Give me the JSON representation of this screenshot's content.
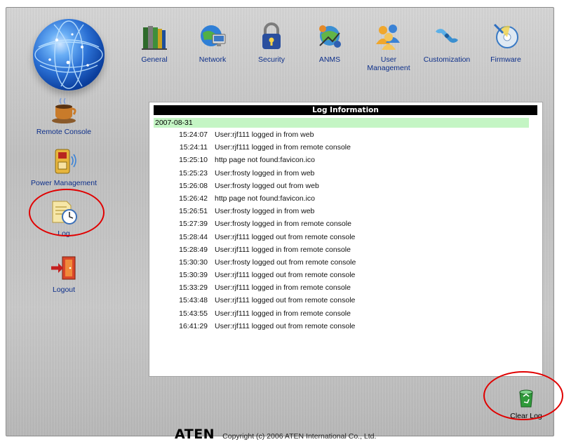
{
  "nav": {
    "items": [
      {
        "label": "General",
        "icon": "books-icon"
      },
      {
        "label": "Network",
        "icon": "network-icon"
      },
      {
        "label": "Security",
        "icon": "lock-icon"
      },
      {
        "label": "ANMS",
        "icon": "anms-icon"
      },
      {
        "label": "User\nManagement",
        "icon": "users-icon"
      },
      {
        "label": "Customization",
        "icon": "wrench-icon"
      },
      {
        "label": "Firmware",
        "icon": "disc-icon"
      }
    ]
  },
  "sidebar": {
    "items": [
      {
        "label": "Remote Console",
        "icon": "coffee-cup-icon"
      },
      {
        "label": "Power Management",
        "icon": "power-outlet-icon"
      },
      {
        "label": "Log",
        "icon": "log-clock-icon"
      },
      {
        "label": "Logout",
        "icon": "exit-door-icon"
      }
    ]
  },
  "log": {
    "title": "Log Information",
    "date": "2007-08-31",
    "entries": [
      {
        "time": "15:24:07",
        "message": "User:rjf111 logged in from web"
      },
      {
        "time": "15:24:11",
        "message": "User:rjf111 logged in from remote console"
      },
      {
        "time": "15:25:10",
        "message": "http page not found:favicon.ico"
      },
      {
        "time": "15:25:23",
        "message": "User:frosty logged in from web"
      },
      {
        "time": "15:26:08",
        "message": "User:frosty logged out from web"
      },
      {
        "time": "15:26:42",
        "message": "http page not found:favicon.ico"
      },
      {
        "time": "15:26:51",
        "message": "User:frosty logged in from web"
      },
      {
        "time": "15:27:39",
        "message": "User:frosty logged in from remote console"
      },
      {
        "time": "15:28:44",
        "message": "User:rjf111 logged out from remote console"
      },
      {
        "time": "15:28:49",
        "message": "User:rjf111 logged in from remote console"
      },
      {
        "time": "15:30:30",
        "message": "User:frosty logged out from remote console"
      },
      {
        "time": "15:30:39",
        "message": "User:rjf111 logged out from remote console"
      },
      {
        "time": "15:33:29",
        "message": "User:rjf111 logged in from remote console"
      },
      {
        "time": "15:43:48",
        "message": "User:rjf111 logged out from remote console"
      },
      {
        "time": "15:43:55",
        "message": "User:rjf111 logged in from remote console"
      },
      {
        "time": "16:41:29",
        "message": "User:rjf111 logged out from remote console"
      }
    ]
  },
  "actions": {
    "clear_log_label": "Clear Log",
    "clear_log_icon": "recycle-bin-icon"
  },
  "footer": {
    "brand": "ATEN",
    "copyright": "Copyright (c) 2006 ATEN International Co., Ltd."
  },
  "colors": {
    "link_text": "#0d2f8a",
    "header_bg": "#000000",
    "date_row_bg": "#c4f5c4",
    "annotation_circle": "#e00000"
  }
}
